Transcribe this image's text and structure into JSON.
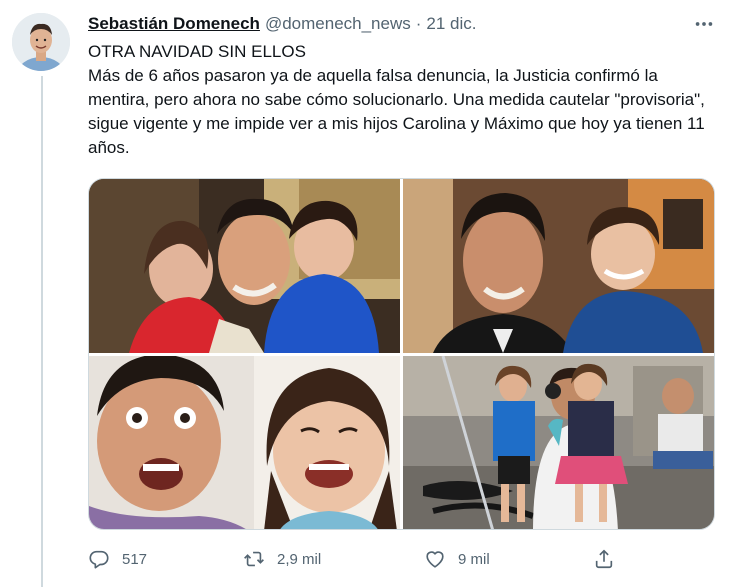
{
  "tweet": {
    "author": {
      "name": "Sebastián Domenech",
      "handle": "@domenech_news",
      "avatar_alt": "profile photo"
    },
    "separator": "·",
    "date": "21 dic.",
    "text_lines": [
      "OTRA NAVIDAD SIN ELLOS",
      "Más de 6 años pasaron ya de aquella falsa denuncia, la Justicia confirmó la mentira, pero ahora no sabe cómo solucionarlo. Una medida cautelar \"provisoria\", sigue vigente y me impide ver a mis hijos Carolina y Máximo que hoy ya tienen 11 años."
    ],
    "media": [
      {
        "description": "man with two young children kissing his cheeks"
      },
      {
        "description": "man smiling next to a young boy in a blue sweater"
      },
      {
        "description": "close-up selfie of man and a smiling girl"
      },
      {
        "description": "man crouching with two children on a street"
      }
    ],
    "actions": {
      "replies": "517",
      "retweets": "2,9 mil",
      "likes": "9 mil"
    }
  },
  "icons": {
    "more": "more-icon",
    "reply": "reply-icon",
    "retweet": "retweet-icon",
    "like": "heart-icon",
    "share": "share-icon"
  },
  "colors": {
    "text": "#0f1419",
    "secondary": "#536471",
    "divider": "#cfd9de"
  }
}
